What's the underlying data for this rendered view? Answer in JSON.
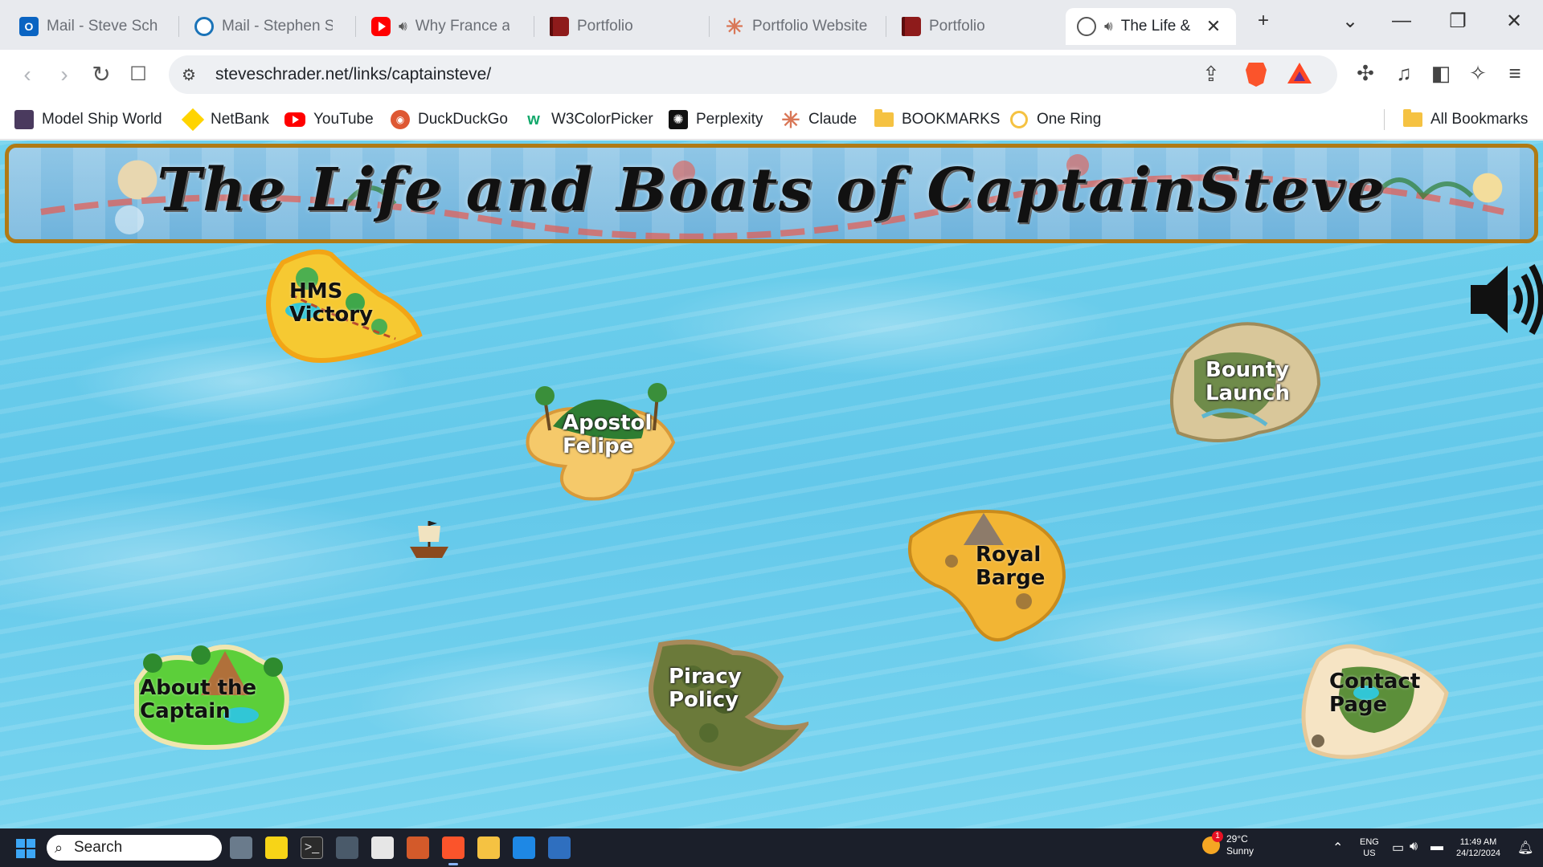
{
  "tabs": [
    {
      "title": "Mail - Steve Schra",
      "icon": "outlook-icon",
      "active": false
    },
    {
      "title": "Mail - Stephen Sc",
      "icon": "mail-icon",
      "active": false
    },
    {
      "title": "Why France a",
      "icon": "youtube-icon",
      "active": false,
      "playing": true
    },
    {
      "title": "Portfolio",
      "icon": "book-icon",
      "active": false
    },
    {
      "title": "Portfolio Website",
      "icon": "claude-icon",
      "active": false
    },
    {
      "title": "Portfolio",
      "icon": "book-icon",
      "active": false
    },
    {
      "title": "The Life &",
      "icon": "globe-icon",
      "active": true,
      "playing": true
    }
  ],
  "window_controls": {
    "new_tab": "+",
    "tab_menu": "⌄",
    "minimize": "—",
    "restore": "❐",
    "close": "✕"
  },
  "toolbar": {
    "back": "‹",
    "forward": "›",
    "reload": "↻",
    "bookmark": "☐",
    "url": "steveschrader.net/links/captainsteve/",
    "extensions": "✣",
    "media": "♫",
    "sidebar": "◧",
    "leo": "✧",
    "menu": "≡"
  },
  "bookmarks": [
    {
      "label": "Model Ship World",
      "icon": "model-ship-world-icon"
    },
    {
      "label": "NetBank",
      "icon": "netbank-icon"
    },
    {
      "label": "YouTube",
      "icon": "youtube-icon"
    },
    {
      "label": "DuckDuckGo",
      "icon": "duckduckgo-icon"
    },
    {
      "label": "W3ColorPicker",
      "icon": "w3-icon"
    },
    {
      "label": "Perplexity",
      "icon": "perplexity-icon"
    },
    {
      "label": "Claude",
      "icon": "claude-icon"
    },
    {
      "label": "BOOKMARKS",
      "icon": "folder-icon"
    },
    {
      "label": "One Ring",
      "icon": "ring-icon"
    }
  ],
  "all_bookmarks": "All Bookmarks",
  "page": {
    "banner_title": "The Life and Boats of CaptainSteve",
    "islands": [
      {
        "name": "hms-victory",
        "line1": "HMS",
        "line2": "Victory",
        "style": "dark"
      },
      {
        "name": "apostol-felipe",
        "line1": "Apostol",
        "line2": "Felipe",
        "style": "light"
      },
      {
        "name": "bounty-launch",
        "line1": "Bounty",
        "line2": "Launch",
        "style": "light"
      },
      {
        "name": "royal-barge",
        "line1": "Royal",
        "line2": "Barge",
        "style": "dark"
      },
      {
        "name": "about-the-captain",
        "line1": "About the",
        "line2": "Captain",
        "style": "dark"
      },
      {
        "name": "piracy-policy",
        "line1": "Piracy",
        "line2": "Policy",
        "style": "light"
      },
      {
        "name": "contact-page",
        "line1": "Contact",
        "line2": "Page",
        "style": "dark"
      }
    ]
  },
  "taskbar": {
    "search_placeholder": "Search",
    "weather_temp": "29°C",
    "weather_desc": "Sunny",
    "weather_badge": "1",
    "lang1": "ENG",
    "lang2": "US",
    "time": "11:49 AM",
    "date": "24/12/2024"
  }
}
